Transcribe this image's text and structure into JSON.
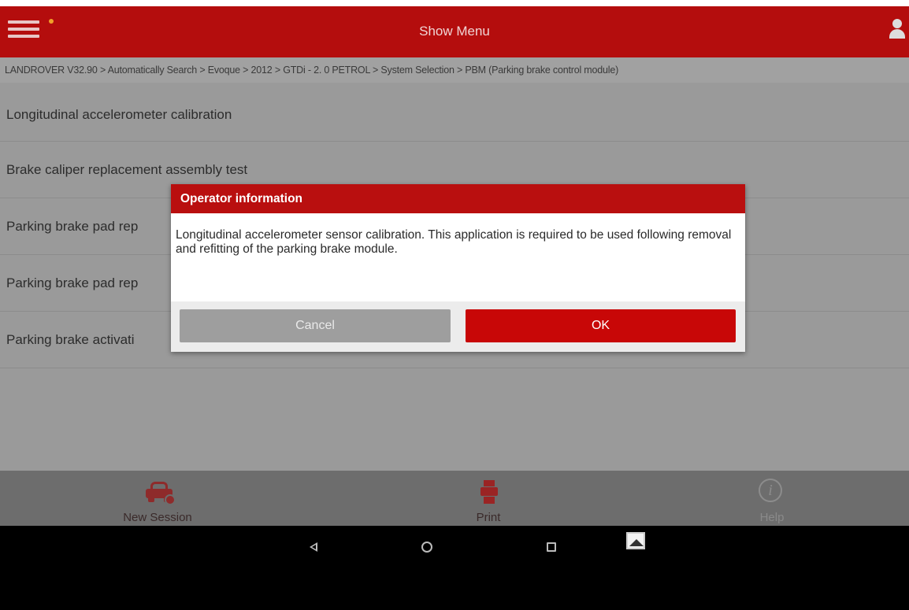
{
  "header": {
    "title": "Show Menu",
    "accent_color": "#b40d0d"
  },
  "breadcrumb": "LANDROVER V32.90 > Automatically Search > Evoque > 2012 > GTDi - 2. 0 PETROL > System Selection > PBM (Parking brake control module)",
  "list": {
    "items": [
      "Longitudinal accelerometer calibration",
      "Brake caliper replacement assembly test",
      "Parking brake pad rep",
      "Parking brake pad rep",
      "Parking brake activati"
    ]
  },
  "dialog": {
    "title": "Operator information",
    "message": "Longitudinal accelerometer sensor calibration. This application is required to be used following removal and refitting of the parking brake module.",
    "cancel_label": "Cancel",
    "ok_label": "OK"
  },
  "bottombar": {
    "new_session_label": "New Session",
    "print_label": "Print",
    "help_label": "Help",
    "help_glyph": "i"
  },
  "icons": [
    "menu-icon",
    "user-icon",
    "car-icon",
    "print-icon",
    "help-icon",
    "back-icon",
    "home-icon",
    "recent-apps-icon",
    "gallery-icon"
  ]
}
